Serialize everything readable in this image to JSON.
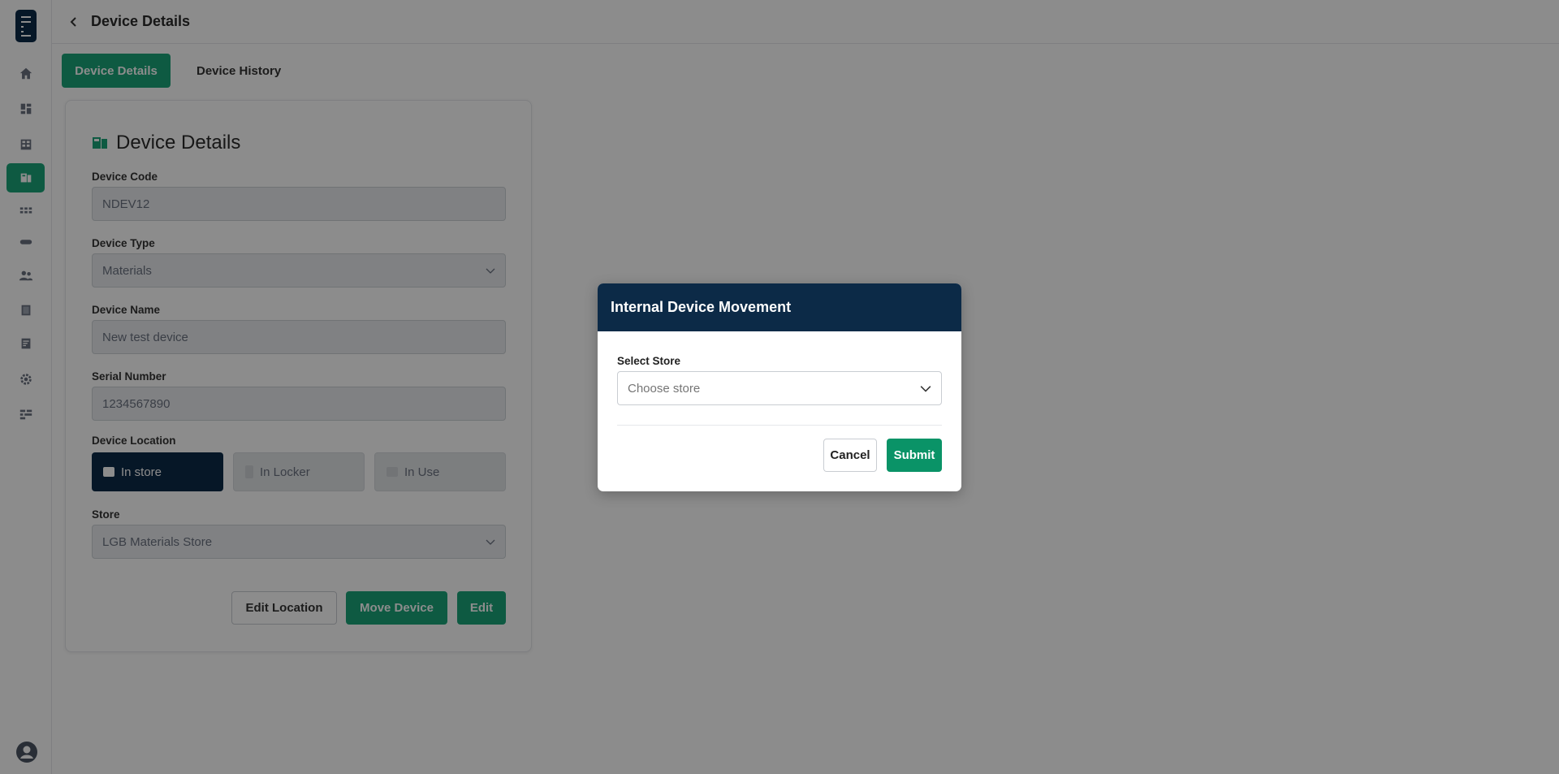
{
  "sidebar": {
    "items": [
      {
        "icon": "home-icon"
      },
      {
        "icon": "dashboard-icon"
      },
      {
        "icon": "storage-icon"
      },
      {
        "icon": "devices-icon",
        "active": true
      },
      {
        "icon": "grid-icon"
      },
      {
        "icon": "tag-icon"
      },
      {
        "icon": "users-icon"
      },
      {
        "icon": "building-icon"
      },
      {
        "icon": "report-icon"
      },
      {
        "icon": "settings-icon"
      },
      {
        "icon": "list-icon"
      }
    ],
    "avatar_icon": "user-avatar-icon"
  },
  "header": {
    "title": "Device Details"
  },
  "tabs": [
    {
      "label": "Device Details",
      "active": true
    },
    {
      "label": "Device History",
      "active": false
    }
  ],
  "card": {
    "title": "Device Details",
    "fields": {
      "device_code": {
        "label": "Device Code",
        "value": "NDEV12"
      },
      "device_type": {
        "label": "Device Type",
        "value": "Materials"
      },
      "device_name": {
        "label": "Device Name",
        "value": "New test device"
      },
      "serial_number": {
        "label": "Serial Number",
        "value": "1234567890"
      },
      "device_location": {
        "label": "Device Location"
      },
      "store": {
        "label": "Store",
        "value": "LGB Materials Store"
      }
    },
    "location_options": [
      {
        "label": "In store",
        "selected": true
      },
      {
        "label": "In Locker",
        "selected": false
      },
      {
        "label": "In Use",
        "selected": false
      }
    ],
    "actions": {
      "edit_location": "Edit Location",
      "move_device": "Move Device",
      "edit": "Edit"
    }
  },
  "modal": {
    "title": "Internal Device Movement",
    "select_label": "Select Store",
    "select_placeholder": "Choose store",
    "cancel": "Cancel",
    "submit": "Submit"
  },
  "colors": {
    "brand_navy": "#0c2a47",
    "brand_green": "#1aa579",
    "submit_green": "#0a9367"
  }
}
